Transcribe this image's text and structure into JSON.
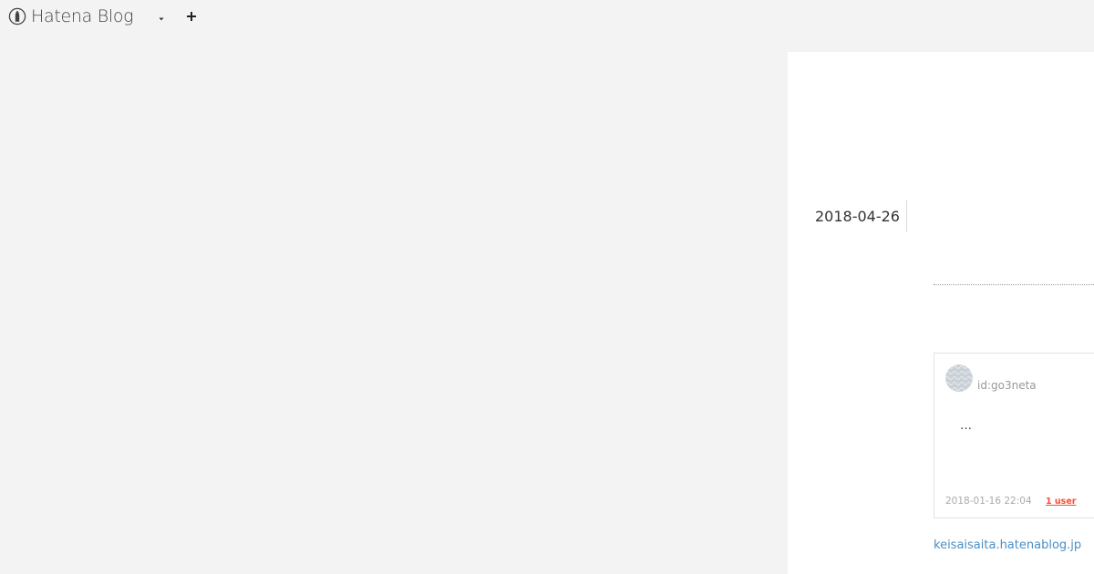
{
  "topbar": {
    "logo_text": "Hatena Blog",
    "logo_icon": "hatena-blog-logo",
    "dropdown_icon": "caret-down-icon",
    "add_icon": "plus-icon"
  },
  "entry": {
    "date": "2018-04-26"
  },
  "card": {
    "user_id": "id:go3neta",
    "excerpt": "…",
    "timestamp": "2018-01-16 22:04",
    "bookmark_count": "1 user"
  },
  "site": {
    "domain": "keisaisaita.hatenablog.jp"
  },
  "colors": {
    "background": "#f3f3f3",
    "panel": "#ffffff",
    "link": "#4a8ec6",
    "bookmark_accent": "#ff4b33"
  }
}
